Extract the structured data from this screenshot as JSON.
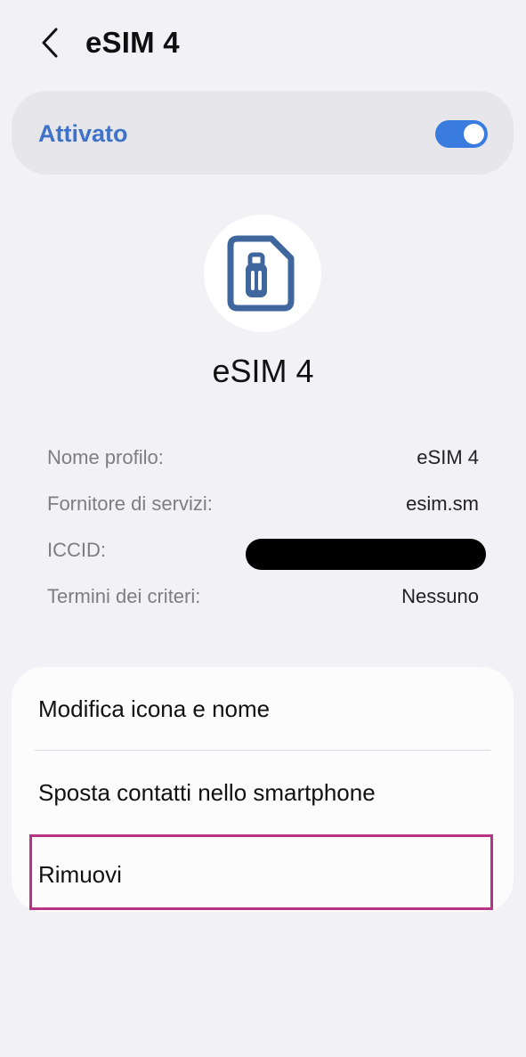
{
  "header": {
    "title": "eSIM 4",
    "back_icon": "back-chevron-icon"
  },
  "activation": {
    "label": "Attivato",
    "enabled": true,
    "toggle_color": "#3a7be0",
    "label_color": "#3e73c9"
  },
  "profile": {
    "icon": "esim-luggage-icon",
    "icon_color": "#3f679d",
    "name": "eSIM 4"
  },
  "info": {
    "rows": [
      {
        "label": "Nome profilo:",
        "value": "eSIM 4"
      },
      {
        "label": "Fornitore di servizi:",
        "value": "esim.sm"
      },
      {
        "label": "ICCID:",
        "value": ""
      },
      {
        "label": "Termini dei criteri:",
        "value": "Nessuno"
      }
    ]
  },
  "actions": {
    "items": [
      {
        "label": "Modifica icona e nome"
      },
      {
        "label": "Sposta contatti nello smartphone"
      },
      {
        "label": "Rimuovi"
      }
    ],
    "highlight_color": "#b53485"
  }
}
